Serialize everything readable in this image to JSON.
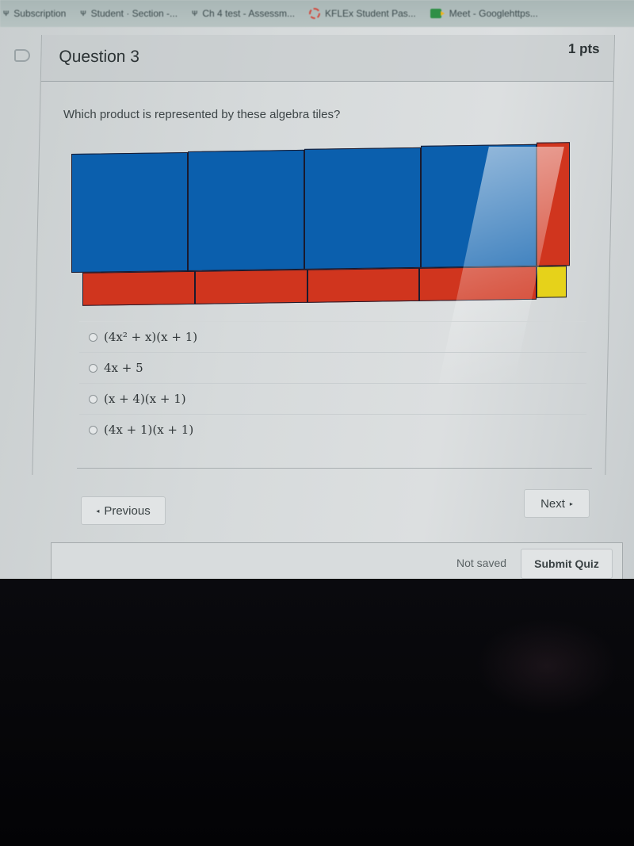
{
  "bookmarks": [
    {
      "icon": "web-icon",
      "label": "Subscription"
    },
    {
      "icon": "web-icon",
      "label": "Student · Section -..."
    },
    {
      "icon": "web-icon",
      "label": "Ch 4 test - Assessm..."
    },
    {
      "icon": "kflex-icon",
      "label": "KFLEx Student Pas..."
    },
    {
      "icon": "meet-icon",
      "label": "Meet - Googlehttps..."
    }
  ],
  "question": {
    "title": "Question 3",
    "points": "1 pts",
    "prompt": "Which product is represented by these algebra tiles?",
    "tiles": {
      "description": "4 x² tiles (blue), 4 x tiles horizontal (red), 1 x tile vertical (red), 1 unit tile (yellow)",
      "colors": {
        "x_squared": "#0b5fad",
        "x": "#d0351e",
        "unit": "#e6d21a",
        "border": "#1a1a2e"
      },
      "top_row": [
        "x²",
        "x²",
        "x²",
        "x²",
        "x"
      ],
      "bottom_row": [
        "x",
        "x",
        "x",
        "x",
        "1"
      ]
    },
    "answers": [
      {
        "label": "(4x² + x)(x + 1)",
        "selected": false
      },
      {
        "label": "4x + 5",
        "selected": false
      },
      {
        "label": "(x + 4)(x + 1)",
        "selected": false
      },
      {
        "label": "(4x + 1)(x + 1)",
        "selected": false
      }
    ]
  },
  "nav": {
    "previous_label": "Previous",
    "next_label": "Next",
    "prev_icon": "◂",
    "next_icon": "▸"
  },
  "footer": {
    "status": "Not saved",
    "submit_label": "Submit Quiz"
  }
}
